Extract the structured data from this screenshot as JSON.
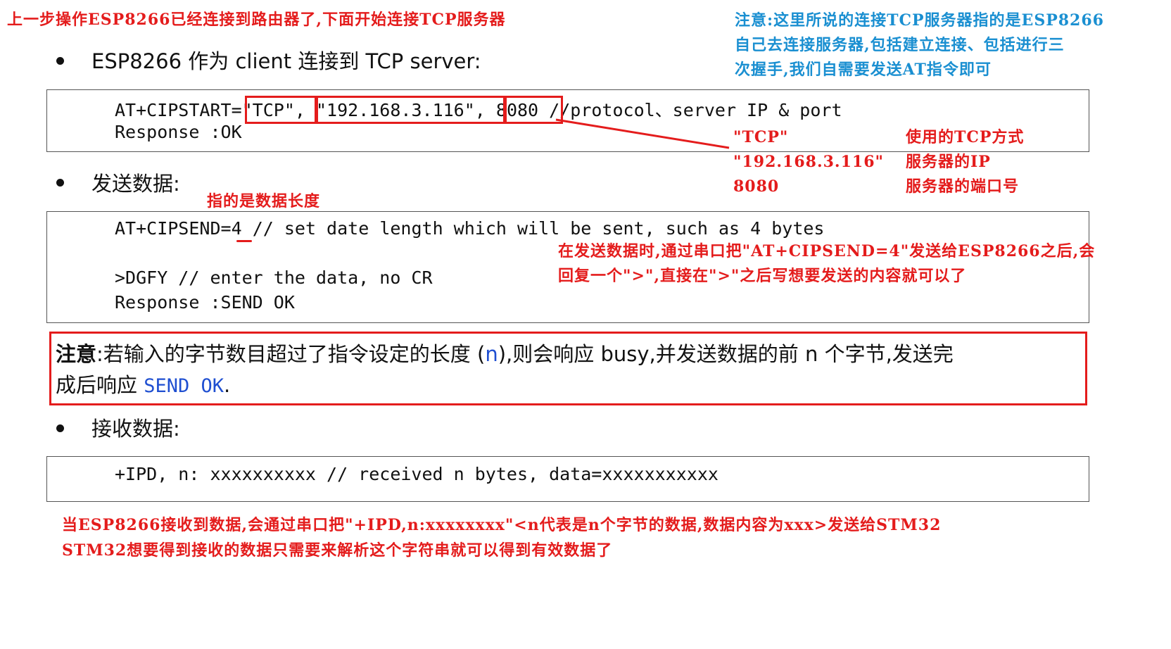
{
  "top_note": "上一步操作ESP8266已经连接到路由器了,下面开始连接TCP服务器",
  "right_note": [
    "注意:这里所说的连接TCP服务器指的是ESP8266",
    "自己去连接服务器,包括建立连接、包括进行三",
    "次握手,我们自需要发送AT指令即可"
  ],
  "section1": {
    "bullet": "ESP8266 作为 client 连接到 TCP server:",
    "code_prefix": "AT+CIPSTART=",
    "param_tcp": "\"TCP\",",
    "param_ip": "\"192.168.3.116\",",
    "param_port": "8080",
    "code_comment": "//protocol、server IP & port",
    "response": "Response :OK"
  },
  "param_table": {
    "rows": [
      {
        "param": "\"TCP\"",
        "desc": "使用的TCP方式"
      },
      {
        "param": "\"192.168.3.116\"",
        "desc": "服务器的IP"
      },
      {
        "param": "8080",
        "desc": "服务器的端口号"
      }
    ]
  },
  "section2": {
    "bullet": "发送数据:",
    "length_note": "指的是数据长度",
    "cipsend_prefix": "AT+CIPSEND=",
    "cipsend_value": "4",
    "cipsend_comment": "// set date length which will be sent,  such as 4 bytes",
    "data_line": ">DGFY         // enter the data,  no CR",
    "response": "Response :SEND OK",
    "annotation": [
      "在发送数据时,通过串口把\"AT+CIPSEND=4\"发送给ESP8266之后,会",
      "回复一个\">\",直接在\">\"之后写想要发送的内容就可以了"
    ]
  },
  "warning": {
    "label": "注意",
    "line1_a": ":若输入的字节数目超过了指令设定的长度 (",
    "n1": "n",
    "line1_b": "),则会响应 busy,并发送数据的前 n 个字节,发送完",
    "line2_a": "成后响应 ",
    "send_ok": "SEND OK",
    "line2_b": "."
  },
  "section3": {
    "bullet": "接收数据:",
    "code": "+IPD, n: xxxxxxxxxx    // received n bytes,  data=xxxxxxxxxxx",
    "annotation": [
      "当ESP8266接收到数据,会通过串口把\"+IPD,n:xxxxxxxx\"<n代表是n个字节的数据,数据内容为xxx>发送给STM32",
      "STM32想要得到接收的数据只需要来解析这个字符串就可以得到有效数据了"
    ]
  },
  "colors": {
    "annotation_red": "#e41c1c",
    "annotation_blue": "#1a8fd1",
    "code_blue": "#1f4fd1"
  }
}
